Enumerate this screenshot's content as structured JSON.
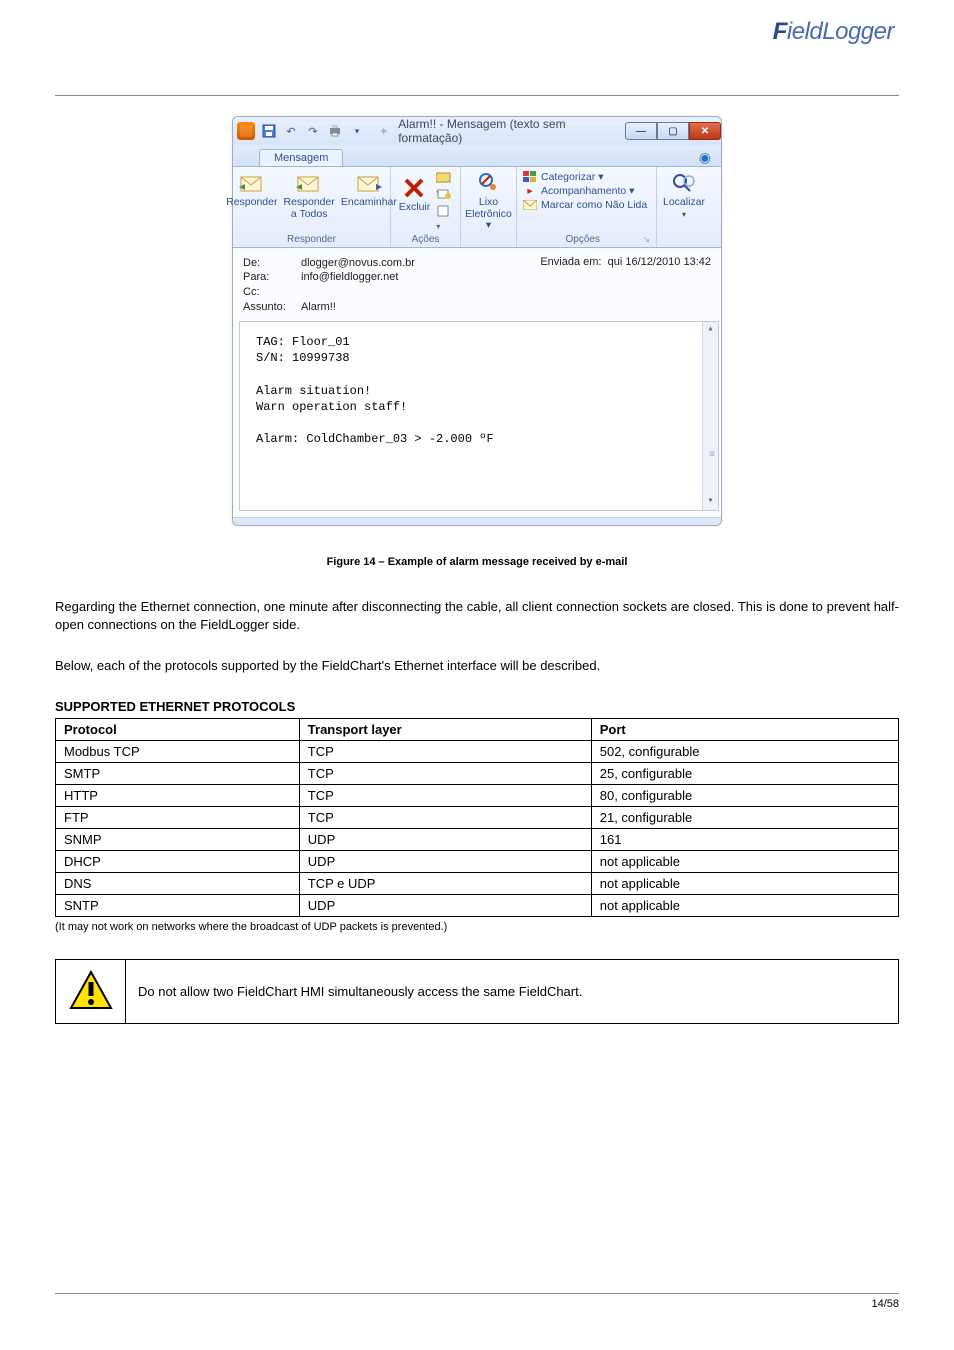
{
  "brand": {
    "a": "F",
    "b": "ieldLogger"
  },
  "screenshot": {
    "title": "Alarm!! - Mensagem (texto sem formatação)",
    "tab": "Mensagem",
    "responder_group": {
      "reply": "Responder",
      "reply_all_1": "Responder",
      "reply_all_2": "a Todos",
      "forward": "Encaminhar",
      "label": "Responder"
    },
    "actions_group": {
      "delete": "Excluir",
      "label": "Ações"
    },
    "junk_group": {
      "junk_1": "Lixo",
      "junk_2": "Eletrônico ▾",
      "label": ""
    },
    "options_group": {
      "categorize": "Categorizar ▾",
      "followup": "Acompanhamento ▾",
      "unread": "Marcar como Não Lida",
      "label": "Opções"
    },
    "find_group": {
      "find": "Localizar",
      "label": ""
    },
    "header": {
      "de_lbl": "De:",
      "de": "dlogger@novus.com.br",
      "para_lbl": "Para:",
      "para": "info@fieldlogger.net",
      "cc_lbl": "Cc:",
      "cc": "",
      "assunto_lbl": "Assunto:",
      "assunto": "Alarm!!",
      "sent_lbl": "Enviada em:",
      "sent": "qui 16/12/2010 13:42"
    },
    "body": {
      "l1": "TAG: Floor_01",
      "l2": "S/N: 10999738",
      "l3": "Alarm situation!",
      "l4": "Warn operation staff!",
      "l5": "Alarm:  ColdChamber_03 > -2.000 ºF"
    }
  },
  "figure_label": "Figure 14 – Example of alarm message received by e-mail",
  "paragraphs": {
    "p1": "Regarding the Ethernet connection, one minute after disconnecting the cable, all client connection sockets are closed. This is done to prevent half-open connections on the FieldLogger side.",
    "p2": "Below, each of the protocols supported by the FieldChart's Ethernet interface will be described."
  },
  "section_title": "SUPPORTED ETHERNET PROTOCOLS",
  "table": {
    "h1": "Protocol",
    "h2": "Transport layer",
    "h3": "Port",
    "r1c1": "Modbus TCP",
    "r1c2": "TCP",
    "r1c3": "502, configurable",
    "r2c1": "SMTP",
    "r2c2": "TCP",
    "r2c3": "25, configurable",
    "r3c1": "HTTP",
    "r3c2": "TCP",
    "r3c3": "80, configurable",
    "r4c1": "FTP",
    "r4c2": "TCP",
    "r4c3": "21, configurable",
    "r5c1": "SNMP",
    "r5c2": "UDP",
    "r5c3": "161",
    "r6c1": "DHCP",
    "r6c2": "UDP",
    "r6c3": "not applicable",
    "r7c1": "DNS",
    "r7c2": "TCP e UDP",
    "r7c3": "not applicable",
    "r8c1": "SNTP",
    "r8c2": "UDP",
    "r8c3": "not applicable",
    "note": "(It may not work on networks where the broadcast of UDP packets is prevented.)"
  },
  "warning": "Do not allow two FieldChart HMI simultaneously access the same FieldChart.",
  "page_number": "14/58"
}
